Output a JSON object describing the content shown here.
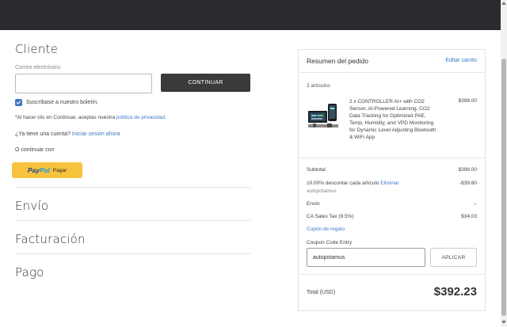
{
  "customer": {
    "title": "Cliente",
    "email_label": "Correo electrónico",
    "email_value": "",
    "continue_label": "CONTINUAR",
    "newsletter_label": "Suscríbase a nuestro boletín.",
    "privacy_prefix": "*Al hacer clic en Continuar, aceptas nuestra ",
    "privacy_link": "política de privacidad",
    "privacy_suffix": ".",
    "account_prefix": "¿Ya tiene una cuenta? ",
    "account_link": "Iniciar sesión ahora",
    "or_continue": "O continuar con",
    "paypal_pay": "Pay",
    "paypal_pal": "Pal",
    "paypal_label": "Pagar"
  },
  "steps": {
    "shipping": "Envío",
    "billing": "Facturación",
    "payment": "Pago"
  },
  "summary": {
    "title": "Resumen del pedido",
    "edit_cart": "Editar carrito",
    "items_count": "2 artículos",
    "product": {
      "description": "2 x CONTROLLER AI+ with CO2 Sensor, AI-Powered Learning, CO2 Data Tracking for Optimized PAE, Temp, Humidity, and VPD Monitoring for Dynamic Level Adjusting Bluetooth & WiFi App",
      "price": "$398.00"
    },
    "subtotal_label": "Subtotal",
    "subtotal_value": "$398.00",
    "discount_label": "10.00% descontar cada artículo ",
    "discount_remove": "Eliminar",
    "discount_code": "autopotamus",
    "discount_value": "-$39.80",
    "shipping_label": "Envío",
    "shipping_value": "--",
    "tax_label": "CA Sales Tax (9.5%)",
    "tax_value": "$34.03",
    "gift_label": "Cupón de regalo",
    "coupon_label": "Coupon Code Entry",
    "coupon_value": "autopotamus",
    "apply_label": "APLICAR",
    "total_label": "Total (USD)",
    "total_value": "$392.23"
  },
  "colors": {
    "topbar": "#2b2a2f",
    "link": "#3a7bc8",
    "checkbox": "#3d74c4",
    "paypal": "#f7c33f",
    "button_dark": "#3a3a3a"
  }
}
